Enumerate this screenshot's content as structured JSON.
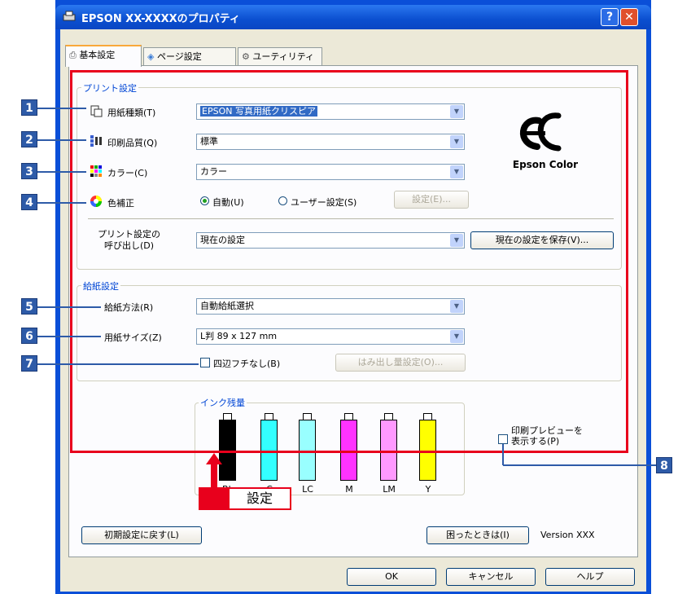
{
  "window": {
    "title": "EPSON XX-XXXXのプロパティ",
    "help_glyph": "?",
    "close_glyph": "✕"
  },
  "tabs": [
    {
      "label": "基本設定",
      "icon": "printer-icon"
    },
    {
      "label": "ページ設定",
      "icon": "page-layout-icon"
    },
    {
      "label": "ユーティリティ",
      "icon": "utility-icon"
    }
  ],
  "print_settings": {
    "group_label": "プリント設定",
    "media_type": {
      "label": "用紙種類(T)",
      "value": "EPSON 写真用紙クリスピア"
    },
    "quality": {
      "label": "印刷品質(Q)",
      "value": "標準"
    },
    "color": {
      "label": "カラー(C)",
      "value": "カラー"
    },
    "color_correction": {
      "label": "色補正",
      "auto_label": "自動(U)",
      "custom_label": "ユーザー設定(S)",
      "settings_button": "設定(E)..."
    },
    "recall": {
      "label_line1": "プリント設定の",
      "label_line2": "呼び出し(D)",
      "value": "現在の設定",
      "save_button": "現在の設定を保存(V)..."
    }
  },
  "logo": {
    "text": "Epson Color"
  },
  "paper_settings": {
    "group_label": "給紙設定",
    "source": {
      "label": "給紙方法(R)",
      "value": "自動給紙選択"
    },
    "size": {
      "label": "用紙サイズ(Z)",
      "value": "L判 89 x 127 mm"
    },
    "borderless": {
      "label": "四辺フチなし(B)"
    },
    "expansion_button": "はみ出し量設定(O)..."
  },
  "ink_levels": {
    "group_label": "インク残量",
    "inks": [
      {
        "label": "Bk",
        "color": "#000000"
      },
      {
        "label": "C",
        "color": "#33ffff"
      },
      {
        "label": "LC",
        "color": "#99ffff"
      },
      {
        "label": "M",
        "color": "#ff33ff"
      },
      {
        "label": "LM",
        "color": "#ff99ff"
      },
      {
        "label": "Y",
        "color": "#ffff00"
      }
    ]
  },
  "preview": {
    "label_line1": "印刷プレビューを",
    "label_line2": "表示する(P)"
  },
  "annotation": {
    "settings_tag": "設定",
    "numbers": [
      "1",
      "2",
      "3",
      "4",
      "5",
      "6",
      "7",
      "8"
    ]
  },
  "buttons": {
    "reset": "初期設定に戻す(L)",
    "help_trouble": "困ったときは(I)",
    "version": "Version XXX",
    "ok": "OK",
    "cancel": "キャンセル",
    "help": "ヘルプ"
  },
  "colors": {
    "highlight": "#e8001c",
    "callout": "#2e5ba8",
    "titlebar": "#0b4fd0"
  }
}
